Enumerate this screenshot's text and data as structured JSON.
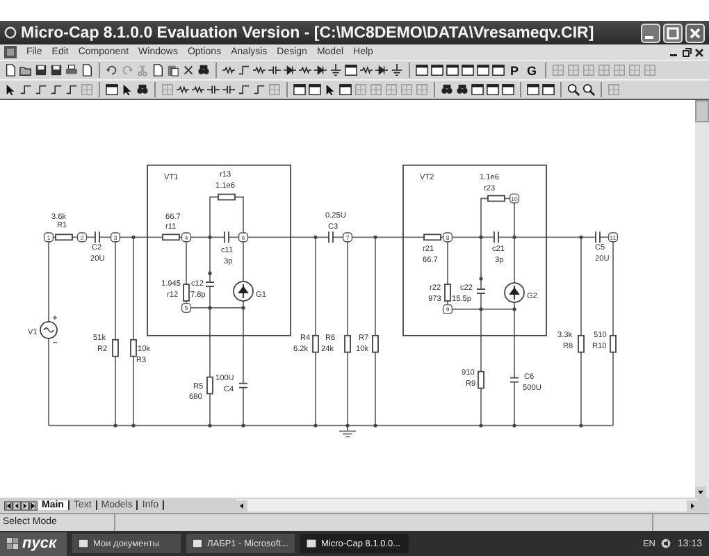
{
  "window": {
    "title": "Micro-Cap 8.1.0.0 Evaluation Version - [C:\\MC8DEMO\\DATA\\Vresameqv.CIR]"
  },
  "menu": [
    "File",
    "Edit",
    "Component",
    "Windows",
    "Options",
    "Analysis",
    "Design",
    "Model",
    "Help"
  ],
  "toolbar_text_buttons": [
    "P",
    "G"
  ],
  "schematic": {
    "blocks": [
      "VT1",
      "VT2"
    ],
    "components": [
      {
        "ref": "R1",
        "value": "3.6k",
        "kind": "resistor"
      },
      {
        "ref": "C2",
        "value": "20U",
        "kind": "capacitor"
      },
      {
        "ref": "V1",
        "kind": "source"
      },
      {
        "ref": "R2",
        "value": "51k",
        "kind": "resistor"
      },
      {
        "ref": "R3",
        "value": "10k",
        "kind": "resistor"
      },
      {
        "ref": "r11",
        "value": "66.7",
        "kind": "resistor"
      },
      {
        "ref": "r13",
        "value": "1.1e6",
        "kind": "resistor"
      },
      {
        "ref": "c11",
        "value": "3p",
        "kind": "capacitor"
      },
      {
        "ref": "r12",
        "value": "1.945",
        "kind": "resistor"
      },
      {
        "ref": "c12",
        "value": "7.8p",
        "kind": "capacitor"
      },
      {
        "ref": "G1",
        "kind": "current_source"
      },
      {
        "ref": "R5",
        "value": "680",
        "kind": "resistor"
      },
      {
        "ref": "C4",
        "value": "100U",
        "kind": "capacitor"
      },
      {
        "ref": "C3",
        "value": "0.25U",
        "kind": "capacitor"
      },
      {
        "ref": "R4",
        "value": "6.2k",
        "kind": "resistor"
      },
      {
        "ref": "R6",
        "value": "24k",
        "kind": "resistor"
      },
      {
        "ref": "R7",
        "value": "10k",
        "kind": "resistor"
      },
      {
        "ref": "r21",
        "value": "66.7",
        "kind": "resistor"
      },
      {
        "ref": "r23",
        "value": "1.1e6",
        "kind": "resistor"
      },
      {
        "ref": "c21",
        "value": "3p",
        "kind": "capacitor"
      },
      {
        "ref": "r22",
        "value": "973",
        "kind": "resistor"
      },
      {
        "ref": "c22",
        "value": "15.5p",
        "kind": "capacitor"
      },
      {
        "ref": "G2",
        "kind": "current_source"
      },
      {
        "ref": "R9",
        "value": "910",
        "kind": "resistor"
      },
      {
        "ref": "C6",
        "value": "500U",
        "kind": "capacitor"
      },
      {
        "ref": "R8",
        "value": "3.3k",
        "kind": "resistor"
      },
      {
        "ref": "R10",
        "value": "510",
        "kind": "resistor"
      },
      {
        "ref": "C5",
        "value": "20U",
        "kind": "capacitor"
      }
    ],
    "nodes": [
      "1",
      "2",
      "3",
      "4",
      "5",
      "6",
      "7",
      "8",
      "9",
      "10",
      "11"
    ]
  },
  "sheet_tabs": [
    {
      "label": "Main",
      "selected": true
    },
    {
      "label": "Text",
      "selected": false
    },
    {
      "label": "Models",
      "selected": false
    },
    {
      "label": "Info",
      "selected": false
    }
  ],
  "status_bar": {
    "mode": "Select Mode"
  },
  "taskbar": {
    "start": "пуск",
    "tasks": [
      {
        "label": "Мои документы",
        "selected": false
      },
      {
        "label": "ЛАБР1 - Microsoft...",
        "selected": false
      },
      {
        "label": "Micro-Cap 8.1.0.0...",
        "selected": true
      }
    ],
    "language": "EN",
    "time": "13:13"
  }
}
